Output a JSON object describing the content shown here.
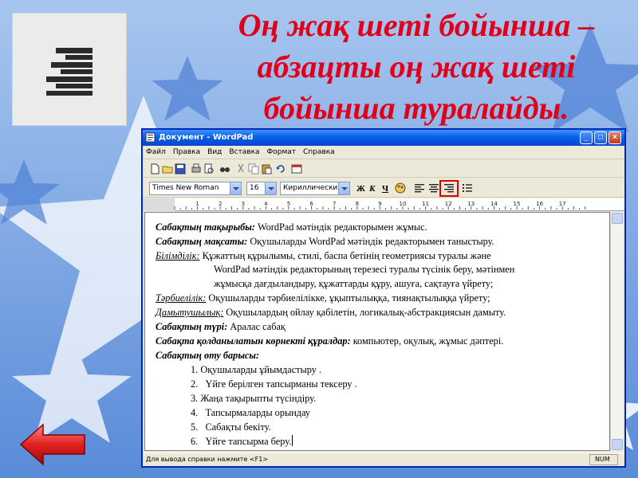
{
  "slide": {
    "title_lines": [
      "Оң жақ шеті бойынша –",
      "абзацты оң жақ шеті",
      "бойынша туралайды."
    ]
  },
  "window": {
    "title": "Документ - WordPad",
    "menu": [
      "Файл",
      "Правка",
      "Вид",
      "Вставка",
      "Формат",
      "Справка"
    ],
    "font_name": "Times New Roman",
    "font_size": "16",
    "script": "Кириллический",
    "bold_label": "Ж",
    "italic_label": "К",
    "underline_label": "Ч",
    "ruler_numbers": [
      "1",
      "2",
      "3",
      "4",
      "5",
      "6",
      "7",
      "8",
      "9",
      "10",
      "11",
      "12",
      "13",
      "14",
      "15",
      "16",
      "17"
    ],
    "status_text": "Для вывода справки нажмите <F1>",
    "status_num": "NUM"
  },
  "document": {
    "topic_label": "Сабақтың тақырыбы:",
    "topic_text": " WordPad мәтіндік редакторымен жұмыс.",
    "goal_label": "Сабақтың мақсаты:",
    "goal_text": " Оқушыларды WordPad мәтіндік редакторымен таныстыру.",
    "edu_label": "Білімділік:",
    "edu_text": "  Құжаттың құрылымы, стилі, баспа бетінің геометриясы туралы және",
    "edu_cont1": "WordPad мәтіндік редакторының терезесі туралы түсінік беру, мәтінмен",
    "edu_cont2": "жұмысқа дағдыландыру, құжаттарды құру, ашуға, сақтауға үйрету;",
    "upbringing_label": "Тәрбиелілік:",
    "upbringing_text": " Оқушыларды тәрбиелілікке, ұқыптылыққа, тиянақтылыққа үйрету;",
    "dev_label": "Дамытушылық:",
    "dev_text": " Оқушылардың ойлау қабілетін, логикалық-абстракциясын дамыту.",
    "type_label": "Сабақтың түрі:",
    "type_text": " Аралас сабақ",
    "aids_label": "Сабақта қолданылатын көрнекті құралдар:",
    "aids_text": " компьютер, оқулық, жұмыс дәптері.",
    "progress_label": "Сабақтың өту барысы:",
    "steps": [
      {
        "num": "1.",
        "text": "Оқушыларды ұйымдастыру ."
      },
      {
        "num": "2.",
        "text": "Үйге берілген тапсырманы тексеру ."
      },
      {
        "num": "3.",
        "text": "Жаңа тақырыпты түсіндіру."
      },
      {
        "num": "4.",
        "text": "Тапсырмаларды орындау"
      },
      {
        "num": "5.",
        "text": "Сабақты бекіту."
      },
      {
        "num": "6.",
        "text": "Үйге тапсырма беру."
      }
    ]
  },
  "icons": {
    "align_right_tile": "align-right-icon",
    "back_button": "back-arrow-icon"
  },
  "colors": {
    "title": "#e0001b",
    "highlight": "#e00000"
  }
}
